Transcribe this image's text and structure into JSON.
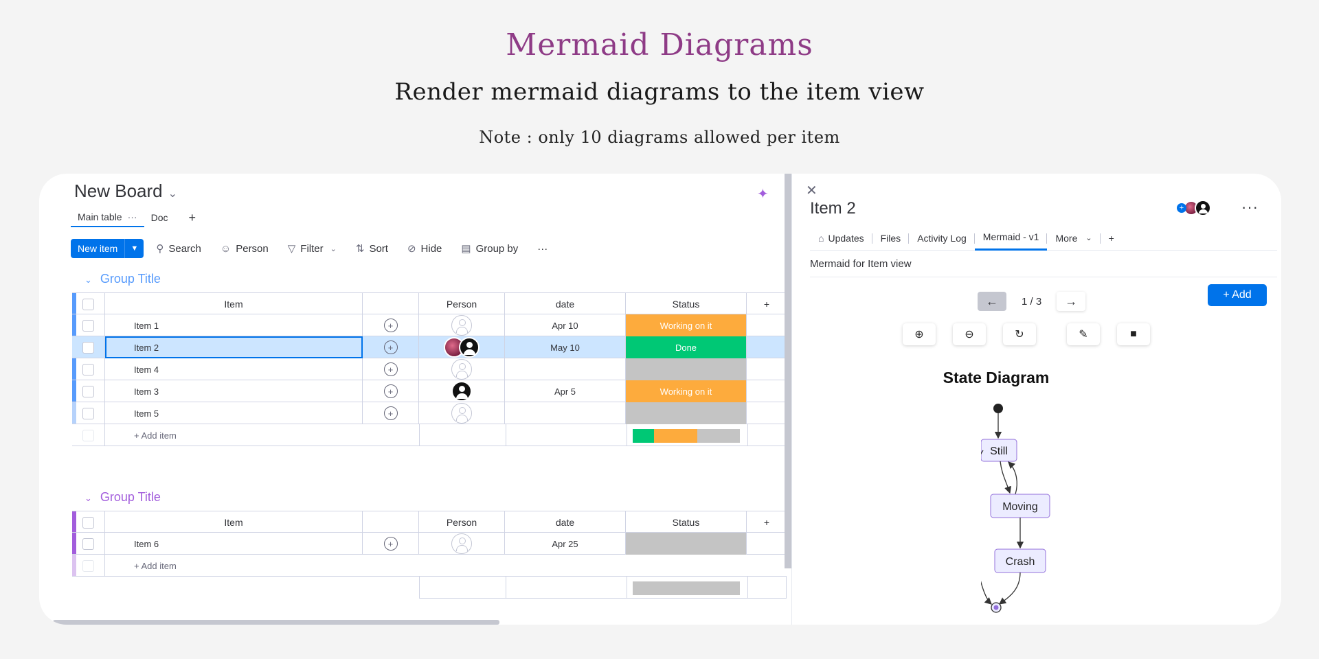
{
  "hero": {
    "title": "Mermaid Diagrams",
    "subtitle": "Render mermaid diagrams to the item view",
    "note": "Note : only 10 diagrams allowed per item"
  },
  "board": {
    "title": "New Board",
    "view_tabs": [
      {
        "label": "Main table",
        "dots": "···"
      },
      {
        "label": "Doc"
      }
    ],
    "toolbar": {
      "new_item": "New item",
      "search": "Search",
      "person": "Person",
      "filter": "Filter",
      "sort": "Sort",
      "hide": "Hide",
      "group_by": "Group by",
      "more": "···"
    },
    "columns": {
      "item": "Item",
      "person": "Person",
      "date": "date",
      "status": "Status"
    },
    "groups": [
      {
        "title": "Group Title",
        "color": "#579bfc",
        "rows": [
          {
            "item": "Item 1",
            "date": "Apr 10",
            "status": "Working on it",
            "status_color": "#fdab3d",
            "person": "empty"
          },
          {
            "item": "Item 2",
            "date": "May 10",
            "status": "Done",
            "status_color": "#00c875",
            "person": "two",
            "selected": true
          },
          {
            "item": "Item 4",
            "date": "",
            "status": "",
            "status_color": "#c4c4c4",
            "person": "empty"
          },
          {
            "item": "Item 3",
            "date": "Apr 5",
            "status": "Working on it",
            "status_color": "#fdab3d",
            "person": "dark"
          },
          {
            "item": "Item 5",
            "date": "",
            "status": "",
            "status_color": "#c4c4c4",
            "person": "empty"
          }
        ],
        "add_item": "+ Add item",
        "summary": [
          {
            "color": "#00c875",
            "share": 0.2
          },
          {
            "color": "#fdab3d",
            "share": 0.4
          },
          {
            "color": "#c4c4c4",
            "share": 0.4
          }
        ]
      },
      {
        "title": "Group Title",
        "color": "#a25ddc",
        "rows": [
          {
            "item": "Item 6",
            "date": "Apr 25",
            "status": "",
            "status_color": "#c4c4c4",
            "person": "empty"
          }
        ],
        "add_item": "+ Add item",
        "summary": [
          {
            "color": "#c4c4c4",
            "share": 1.0
          }
        ]
      }
    ]
  },
  "panel": {
    "title": "Item 2",
    "tabs": [
      "Updates",
      "Files",
      "Activity Log",
      "Mermaid - v1",
      "More"
    ],
    "active_tab": "Mermaid - v1",
    "mermaid_label": "Mermaid for Item view",
    "pager": "1 / 3",
    "add_button": "+ Add",
    "diagram_title": "State Diagram",
    "states": [
      "Still",
      "Moving",
      "Crash"
    ]
  },
  "icons": {
    "prev": "←",
    "next": "→",
    "zoom_in": "⊕",
    "zoom_out": "⊖",
    "reset": "↻",
    "edit": "✎",
    "delete": "■",
    "close": "✕",
    "more": "···",
    "plus": "+"
  }
}
